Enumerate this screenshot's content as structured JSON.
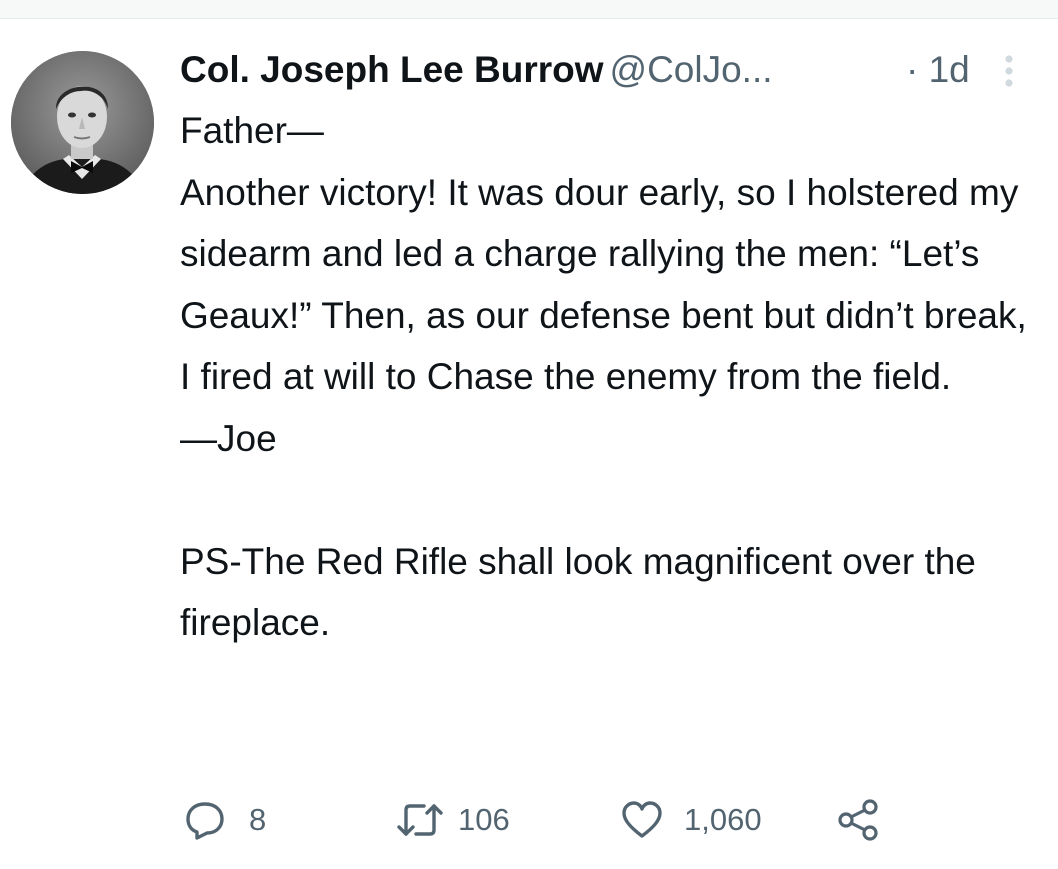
{
  "tweet": {
    "author": {
      "display_name": "Col. Joseph Lee Burrow",
      "handle": "@ColJo...",
      "avatar": "profile-photo"
    },
    "time": "· 1d",
    "body": {
      "salutation": "Father—",
      "main": "Another victory! It was dour early, so I holstered my sidearm and led a charge rallying the men: “Let’s Geaux!” Then, as our defense bent but didn’t break, I fired at will to Chase the enemy from the field.",
      "signoff": "—Joe",
      "ps": "PS-The Red Rifle shall look magnificent over the fireplace."
    },
    "actions": {
      "replies": "8",
      "retweets": "106",
      "likes": "1,060"
    }
  },
  "icons": {
    "reply": "reply-icon",
    "retweet": "retweet-icon",
    "like": "heart-icon",
    "share": "share-icon",
    "more": "more-vertical-icon"
  },
  "colors": {
    "text": "#0f1419",
    "muted": "#536471",
    "more_dots": "#cfd9de"
  }
}
